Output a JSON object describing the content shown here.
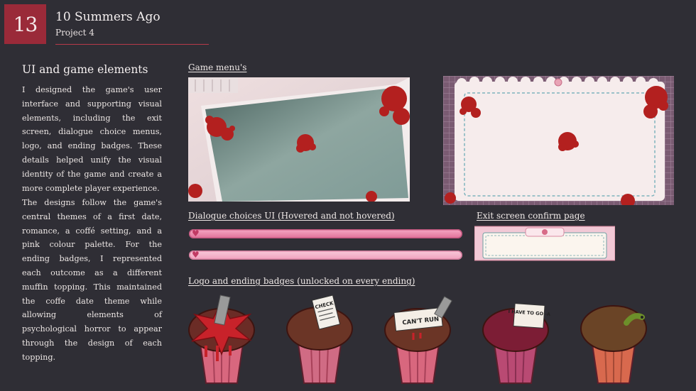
{
  "header": {
    "number": "13",
    "title": "10 Summers Ago",
    "subtitle": "Project  4"
  },
  "intro": {
    "heading": "UI and game elements",
    "paragraph1": "I designed the game's user interface and supporting visual elements, including the exit screen, dialogue choice menus, logo, and ending badges. These details helped unify the visual identity of the game and create a more complete player experience.",
    "paragraph2": "The designs follow the game's central themes of a first date, romance, a coffé setting, and a pink colour palette. For the ending badges, I represented each outcome as a different muffin topping. This maintained the coffe date theme while allowing elements of psychological horror to appear through the design of each topping."
  },
  "sections": {
    "menus_label": "Game menu's",
    "dialogue_label": "Dialogue choices UI (Hovered and not hovered)",
    "exit_label": "Exit screen confirm page",
    "badges_label": "Logo and ending badges (unlocked on every ending)"
  },
  "badge_text": {
    "check": "CHECK",
    "cant_run": "CAN'T RUN",
    "have_to_go": "I HAVE TO GO -A"
  },
  "colors": {
    "background": "#2f2e35",
    "accent": "#9a2a39",
    "pink": "#f3a6c1",
    "blood": "#b3201f"
  }
}
